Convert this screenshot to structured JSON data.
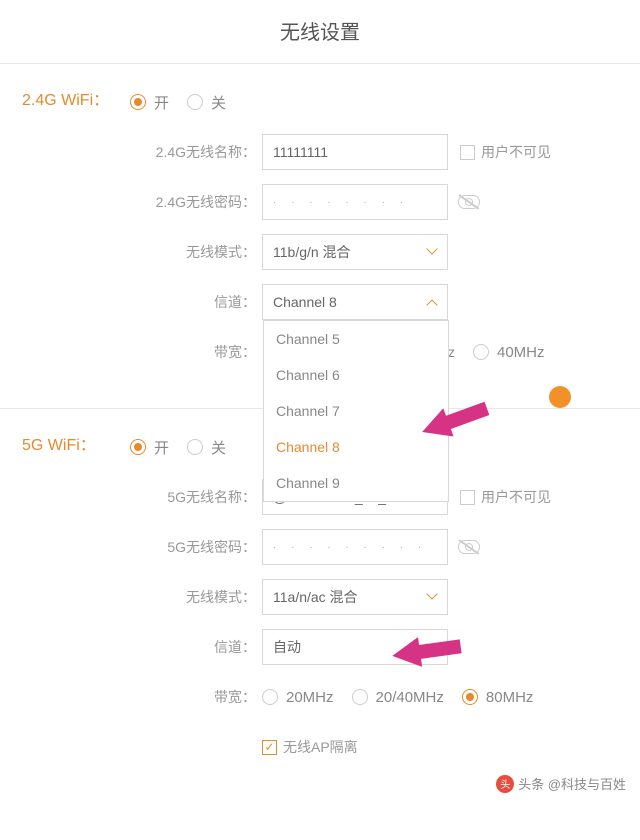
{
  "title": "无线设置",
  "wifi24": {
    "section_label": "2.4G WiFi：",
    "radio_on": "开",
    "radio_off": "关",
    "name_label": "2.4G无线名称：",
    "name_value": "11111111",
    "hidden_label": "用户不可见",
    "pwd_label": "2.4G无线密码：",
    "pwd_value": "· · · · · · · ·",
    "mode_label": "无线模式：",
    "mode_value": "11b/g/n 混合",
    "channel_label": "信道：",
    "channel_value": "Channel 8",
    "bandwidth_label": "带宽：",
    "bandwidth_opt_z": "z",
    "bandwidth_opt_40": "40MHz",
    "dropdown": {
      "items": [
        "Channel 5",
        "Channel 6",
        "Channel 7",
        "Channel 8",
        "Channel 9"
      ],
      "active_index": 3
    }
  },
  "wifi5": {
    "section_label": "5G WiFi：",
    "radio_on": "开",
    "radio_off": "关",
    "name_label": "5G无线名称：",
    "name_value": "@PHICOMM_00_5G",
    "hidden_label": "用户不可见",
    "pwd_label": "5G无线密码：",
    "pwd_value": "· · · · · · · · ·",
    "mode_label": "无线模式：",
    "mode_value": "11a/n/ac 混合",
    "channel_label": "信道：",
    "channel_value": "自动",
    "bandwidth_label": "带宽：",
    "bandwidth_opt_20": "20MHz",
    "bandwidth_opt_2040": "20/40MHz",
    "bandwidth_opt_80": "80MHz",
    "ap_isolation_label": "无线AP隔离"
  },
  "watermark": "头条 @科技与百姓"
}
